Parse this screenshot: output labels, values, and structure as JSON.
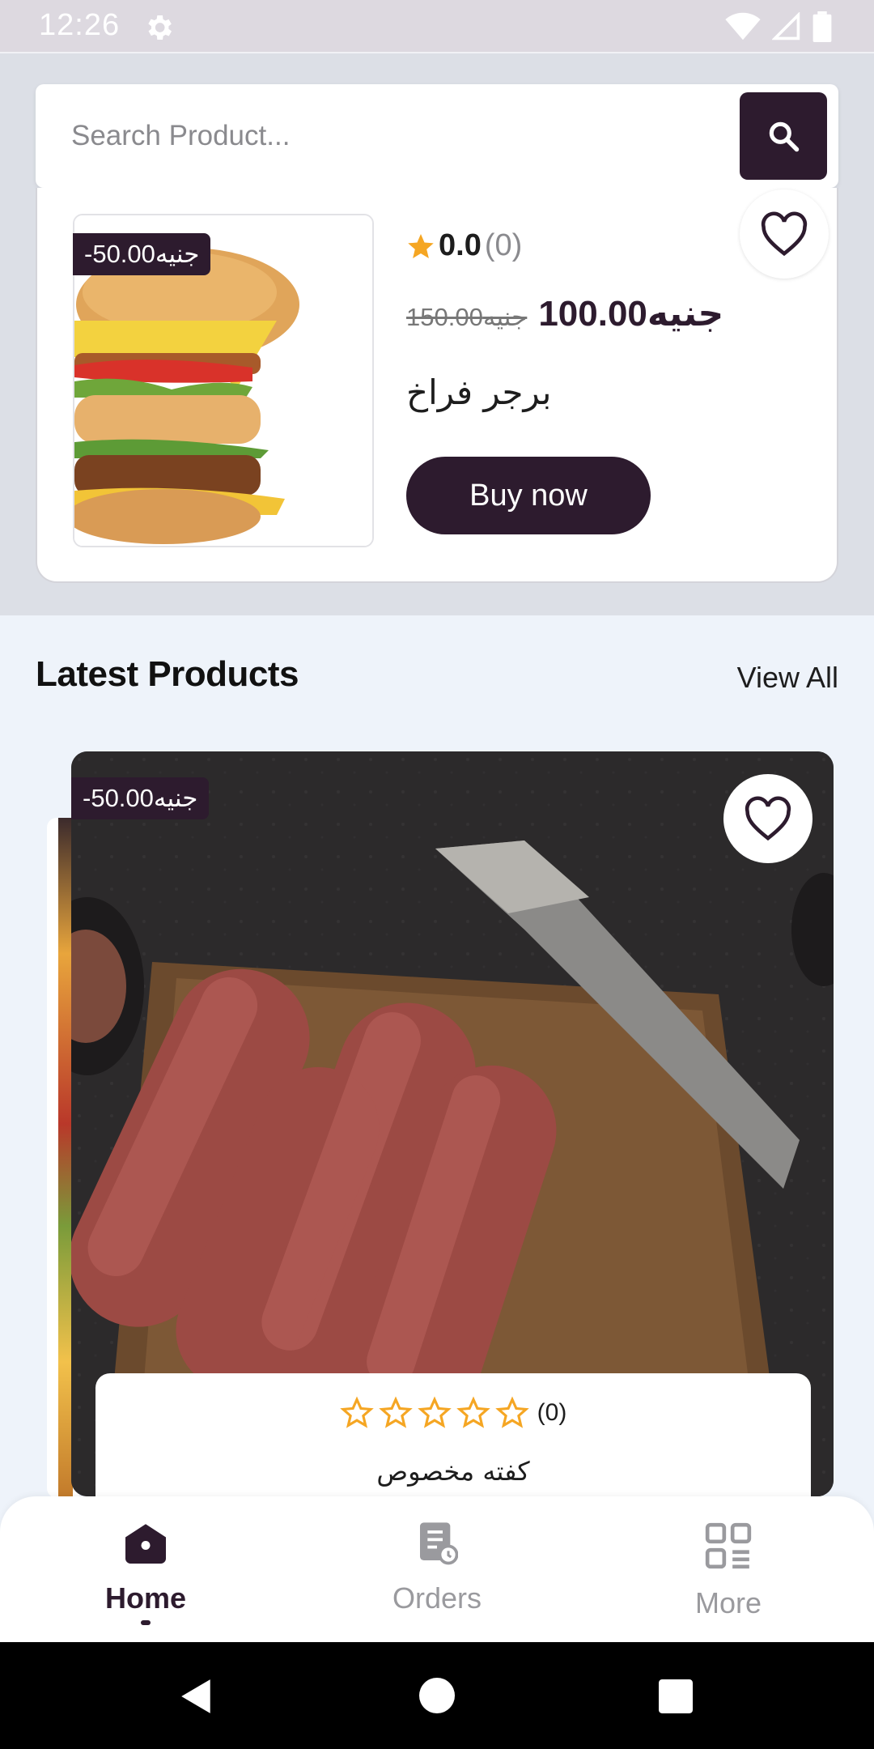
{
  "status_bar": {
    "time": "12:26"
  },
  "search": {
    "placeholder": "Search Product..."
  },
  "featured": {
    "discount": "-50.00جنيه",
    "rating_value": "0.0",
    "rating_count": "(0)",
    "old_price": "150.00جنيه",
    "new_price": "100.00جنيه",
    "name": "برجر فراخ",
    "buy_label": "Buy now"
  },
  "latest": {
    "title": "Latest Products",
    "view_all": "View All",
    "product": {
      "discount": "-50.00جنيه",
      "rating_count": "(0)",
      "stars": 0,
      "name": "كفته مخصوص"
    }
  },
  "nav": {
    "items": [
      {
        "label": "Home",
        "icon": "home-icon",
        "active": true
      },
      {
        "label": "Orders",
        "icon": "orders-icon",
        "active": false
      },
      {
        "label": "More",
        "icon": "grid-icon",
        "active": false
      }
    ]
  },
  "colors": {
    "primary": "#2d1b2e",
    "star": "#f5a623",
    "background": "#eef3fa"
  }
}
